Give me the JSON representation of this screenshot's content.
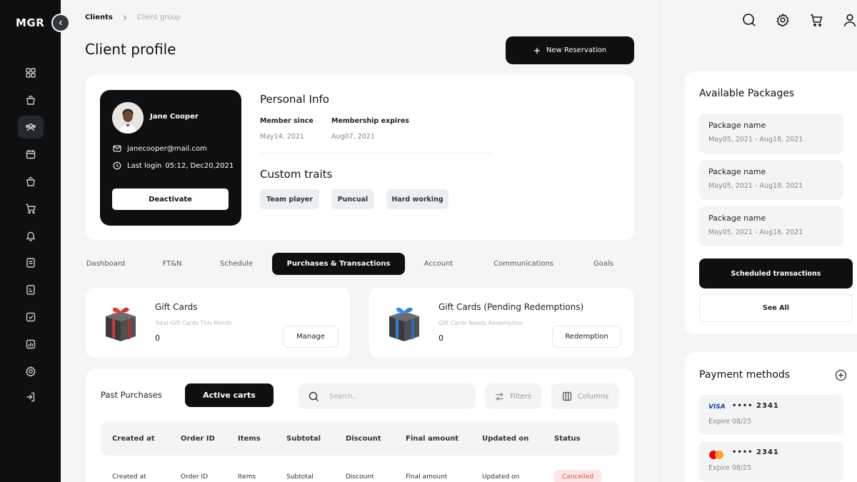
{
  "app": {
    "logo": "MGR"
  },
  "breadcrumb": {
    "items": [
      "Clients",
      "Client group"
    ]
  },
  "page": {
    "title": "Client profile",
    "new_reservation_label": "New Reservation"
  },
  "client": {
    "name": "Jane Cooper",
    "email": "janecooper@mail.com",
    "last_login_label": "Last login",
    "last_login_value": "05:12, Dec20,2021",
    "deactivate_label": "Deactivate"
  },
  "personal_info": {
    "title": "Personal Info",
    "member_since_label": "Member since",
    "member_since_value": "May14, 2021",
    "membership_expires_label": "Membership expires",
    "membership_expires_value": "Aug07, 2021"
  },
  "custom_traits": {
    "title": "Custom traits",
    "items": [
      "Team player",
      "Puncual",
      "Hard working"
    ]
  },
  "tabs": [
    {
      "label": "Dashboard"
    },
    {
      "label": "FT&N"
    },
    {
      "label": "Schedule"
    },
    {
      "label": "Purchases & Transactions",
      "active": true
    },
    {
      "label": "Account"
    },
    {
      "label": "Communications"
    },
    {
      "label": "Goals"
    }
  ],
  "gift_cards": {
    "title": "Gift Cards",
    "subtitle": "Total Gift Cards This Month",
    "value": "0",
    "button_label": "Manage",
    "color": "#c8373b"
  },
  "gift_cards_pending": {
    "title": "Gift Cards (Pending Redemptions)",
    "subtitle": "Gift Cards Needs Redemption",
    "value": "0",
    "button_label": "Redemption",
    "color": "#2f7fd3"
  },
  "purchases": {
    "past_label": "Past Purchases",
    "active_carts_label": "Active carts",
    "search_placeholder": "Search..",
    "filters_label": "Filters",
    "columns_label": "Columns",
    "headers": [
      "Created at",
      "Order ID",
      "Items",
      "Subtotal",
      "Discount",
      "Final amount",
      "Updated on",
      "Status"
    ],
    "rows": [
      {
        "cells": [
          "Created at",
          "Order ID",
          "Items",
          "Subtotal",
          "Discount",
          "Final amount",
          "Updated on"
        ],
        "status": "Cancelled"
      }
    ],
    "status_color": "#e24b4b"
  },
  "packages": {
    "title": "Available Packages",
    "items": [
      {
        "name": "Package name",
        "dates": "May05, 2021 - Aug18, 2021"
      },
      {
        "name": "Package name",
        "dates": "May05, 2021 - Aug18, 2021"
      },
      {
        "name": "Package name",
        "dates": "May05, 2021 - Aug18, 2021"
      }
    ],
    "scheduled_label": "Scheduled transactions",
    "see_all_label": "See All"
  },
  "payment_methods": {
    "title": "Payment methods",
    "cards": [
      {
        "brand": "VISA",
        "masked": "•••• 2341",
        "expiry": "Expire 08/25"
      },
      {
        "brand": "mastercard-icon",
        "masked": "•••• 2341",
        "expiry": "Expire 08/25"
      }
    ]
  },
  "colors": {
    "primary": "#0e0f10",
    "background": "#f5f5f6",
    "surface": "#ffffff",
    "visa": "#1a3fa0"
  }
}
